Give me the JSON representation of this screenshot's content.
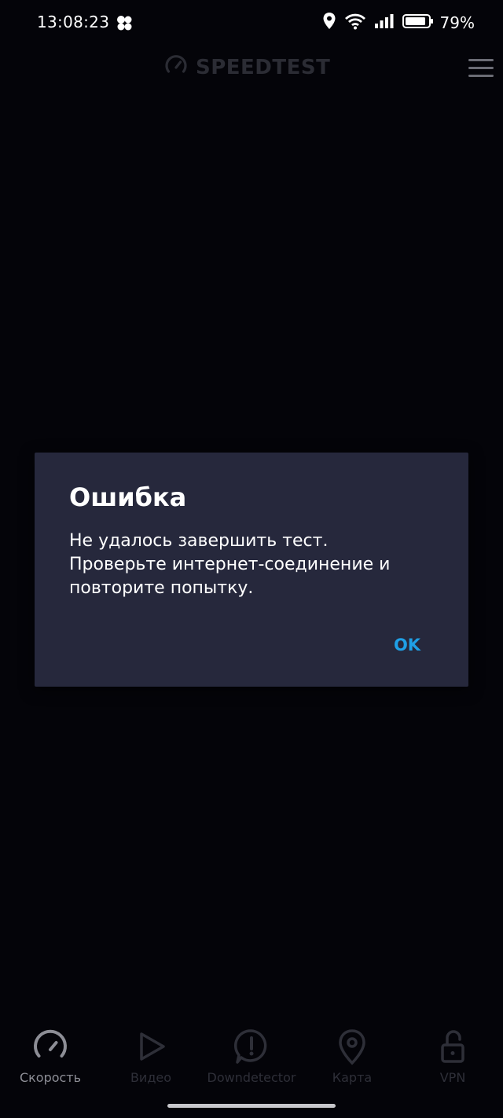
{
  "status_bar": {
    "time": "13:08:23",
    "battery_percent": "79%",
    "icons": [
      "app-notification-icon",
      "location-icon",
      "wifi-icon",
      "signal-icon",
      "battery-icon"
    ]
  },
  "header": {
    "brand_name": "SPEEDTEST",
    "logo_icon": "speedometer-icon",
    "menu_icon": "hamburger-menu-icon"
  },
  "dialog": {
    "title": "Ошибка",
    "message": "Не удалось завершить тест.\nПроверьте интернет-соединение и\nповторите попытку.",
    "ok_label": "OK"
  },
  "bottom_nav": {
    "items": [
      {
        "label": "Скорость",
        "icon": "speedometer-icon",
        "active": true
      },
      {
        "label": "Видео",
        "icon": "play-icon",
        "active": false
      },
      {
        "label": "Downdetector",
        "icon": "alert-bubble-icon",
        "active": false
      },
      {
        "label": "Карта",
        "icon": "map-pin-icon",
        "active": false
      },
      {
        "label": "VPN",
        "icon": "unlock-icon",
        "active": false
      }
    ]
  },
  "colors": {
    "background": "#040409",
    "dialog_background": "#26283c",
    "accent": "#1fa0e6",
    "inactive": "#2e2f38",
    "active_nav": "#8d8e96"
  }
}
